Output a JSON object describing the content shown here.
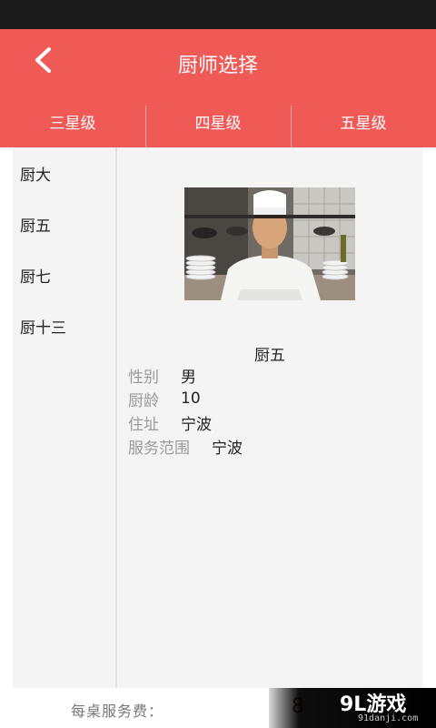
{
  "header": {
    "title": "厨师选择",
    "back_icon": "chevron-left-icon"
  },
  "tabs": [
    {
      "label": "三星级"
    },
    {
      "label": "四星级"
    },
    {
      "label": "五星级"
    }
  ],
  "sidebar": {
    "items": [
      {
        "label": "厨大"
      },
      {
        "label": "厨五"
      },
      {
        "label": "厨七"
      },
      {
        "label": "厨十三"
      }
    ]
  },
  "detail": {
    "name": "厨五",
    "fields": [
      {
        "label": "性别",
        "value": "男"
      },
      {
        "label": "厨龄",
        "value": "10"
      },
      {
        "label": "住址",
        "value": "宁波"
      },
      {
        "label": "服务范围",
        "value": "宁波"
      }
    ]
  },
  "footer": {
    "fee_label": "每桌服务费：",
    "fee_value": "8"
  },
  "watermark": {
    "logo": "9L游戏",
    "url": "91danji.com"
  },
  "colors": {
    "accent": "#ef5a57",
    "status_bar": "#1b1b1b",
    "panel_bg": "#f4f4f4",
    "label_gray": "#9a9a9a"
  }
}
